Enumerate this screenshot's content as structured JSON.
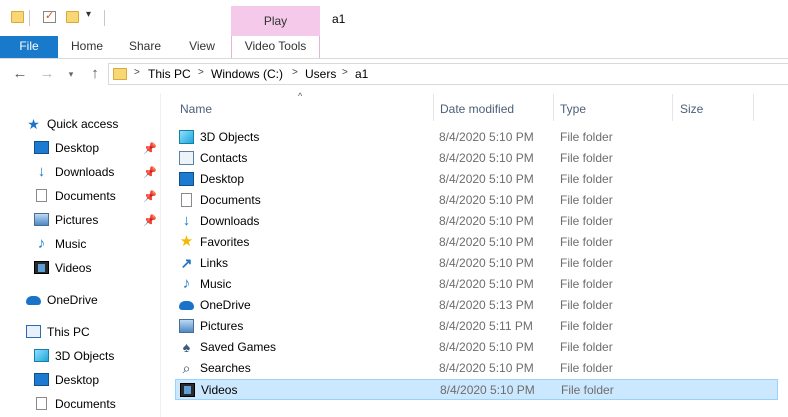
{
  "window": {
    "title": "a1"
  },
  "ribbon": {
    "context_tab": "Play",
    "tabs": [
      "File",
      "Home",
      "Share",
      "View",
      "Video Tools"
    ]
  },
  "address": {
    "crumbs": [
      "This PC",
      "Windows (C:)",
      "Users",
      "a1"
    ],
    "icons": {
      "back": "back-arrow-icon",
      "forward": "forward-arrow-icon",
      "recent": "chevron-down-icon",
      "up": "up-arrow-icon"
    }
  },
  "sidebar": {
    "quick_access": "Quick access",
    "quick_items": [
      "Desktop",
      "Downloads",
      "Documents",
      "Pictures",
      "Music",
      "Videos"
    ],
    "onedrive": "OneDrive",
    "this_pc": "This PC",
    "pc_items": [
      "3D Objects",
      "Desktop",
      "Documents"
    ]
  },
  "columns": {
    "name": "Name",
    "date": "Date modified",
    "type": "Type",
    "size": "Size"
  },
  "files": [
    {
      "name": "3D Objects",
      "date": "8/4/2020 5:10 PM",
      "type": "File folder",
      "icon": "3d-objects-icon"
    },
    {
      "name": "Contacts",
      "date": "8/4/2020 5:10 PM",
      "type": "File folder",
      "icon": "contacts-icon"
    },
    {
      "name": "Desktop",
      "date": "8/4/2020 5:10 PM",
      "type": "File folder",
      "icon": "desktop-icon"
    },
    {
      "name": "Documents",
      "date": "8/4/2020 5:10 PM",
      "type": "File folder",
      "icon": "documents-icon"
    },
    {
      "name": "Downloads",
      "date": "8/4/2020 5:10 PM",
      "type": "File folder",
      "icon": "downloads-icon"
    },
    {
      "name": "Favorites",
      "date": "8/4/2020 5:10 PM",
      "type": "File folder",
      "icon": "favorites-star-icon"
    },
    {
      "name": "Links",
      "date": "8/4/2020 5:10 PM",
      "type": "File folder",
      "icon": "links-icon"
    },
    {
      "name": "Music",
      "date": "8/4/2020 5:10 PM",
      "type": "File folder",
      "icon": "music-icon"
    },
    {
      "name": "OneDrive",
      "date": "8/4/2020 5:13 PM",
      "type": "File folder",
      "icon": "onedrive-cloud-icon"
    },
    {
      "name": "Pictures",
      "date": "8/4/2020 5:11 PM",
      "type": "File folder",
      "icon": "pictures-icon"
    },
    {
      "name": "Saved Games",
      "date": "8/4/2020 5:10 PM",
      "type": "File folder",
      "icon": "saved-games-icon"
    },
    {
      "name": "Searches",
      "date": "8/4/2020 5:10 PM",
      "type": "File folder",
      "icon": "searches-icon"
    },
    {
      "name": "Videos",
      "date": "8/4/2020 5:10 PM",
      "type": "File folder",
      "icon": "videos-icon",
      "selected": true
    }
  ]
}
